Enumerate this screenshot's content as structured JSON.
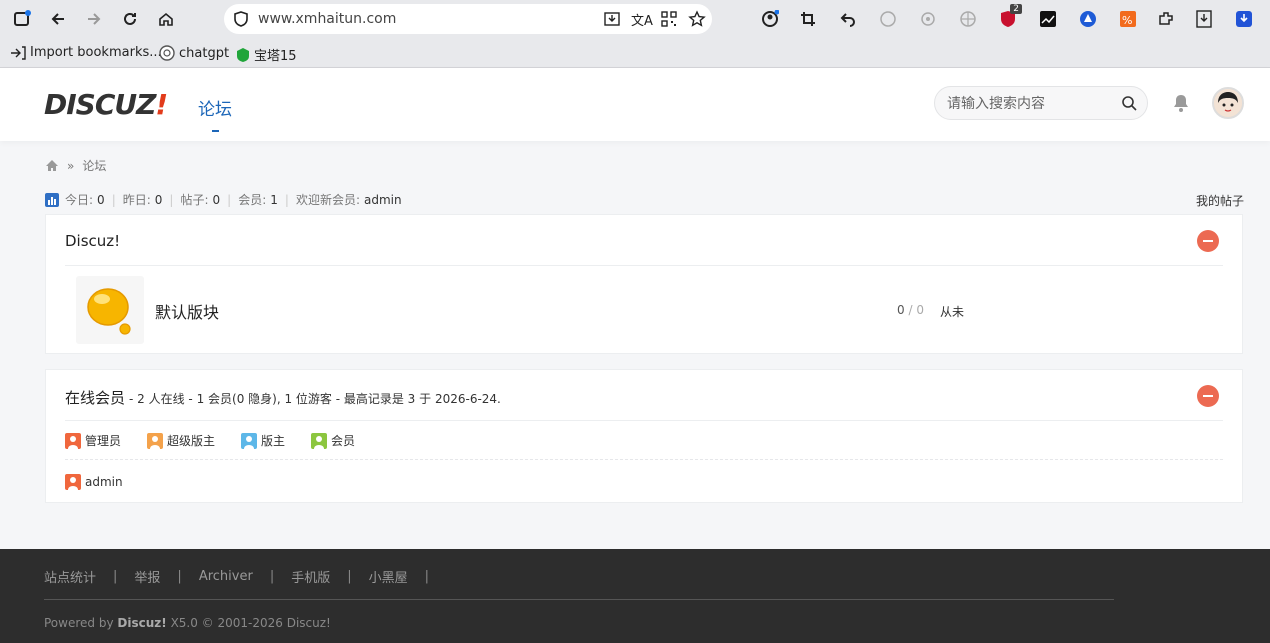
{
  "browser": {
    "url": "www.xmhaitun.com",
    "bookmarks": [
      "Import bookmarks...",
      "chatgpt",
      "宝塔15"
    ],
    "extension_badge": "2"
  },
  "header": {
    "logo_text": "DISCUZ",
    "logo_bang": "!",
    "nav_forum": "论坛",
    "search_placeholder": "请输入搜索内容"
  },
  "breadcrumb": {
    "current": "论坛",
    "separator": "»"
  },
  "stats": {
    "today_label": "今日:",
    "today": "0",
    "yesterday_label": "昨日:",
    "yesterday": "0",
    "posts_label": "帖子:",
    "posts": "0",
    "members_label": "会员:",
    "members": "1",
    "welcome_label": "欢迎新会员:",
    "newest_member": "admin",
    "my_posts": "我的帖子"
  },
  "category": {
    "title": "Discuz!",
    "forum": {
      "name": "默认版块",
      "threads": "0",
      "posts": "0",
      "last_post": "从未"
    }
  },
  "online": {
    "title": "在线会员",
    "description": "- 2 人在线 - 1 会员(0 隐身), 1 位游客 - 最高记录是 3 于 2026-6-24.",
    "legend": [
      {
        "label": "管理员",
        "color": "#f0673d"
      },
      {
        "label": "超级版主",
        "color": "#f4a24b"
      },
      {
        "label": "版主",
        "color": "#5db7e8"
      },
      {
        "label": "会员",
        "color": "#8cc63f"
      }
    ],
    "users": [
      {
        "name": "admin",
        "color": "#f0673d"
      }
    ]
  },
  "footer": {
    "links": [
      "站点统计",
      "举报",
      "Archiver",
      "手机版",
      "小黑屋"
    ],
    "powered_prefix": "Powered by",
    "powered_brand": "Discuz!",
    "powered_suffix": "X5.0 © 2001-2026 Discuz!"
  }
}
